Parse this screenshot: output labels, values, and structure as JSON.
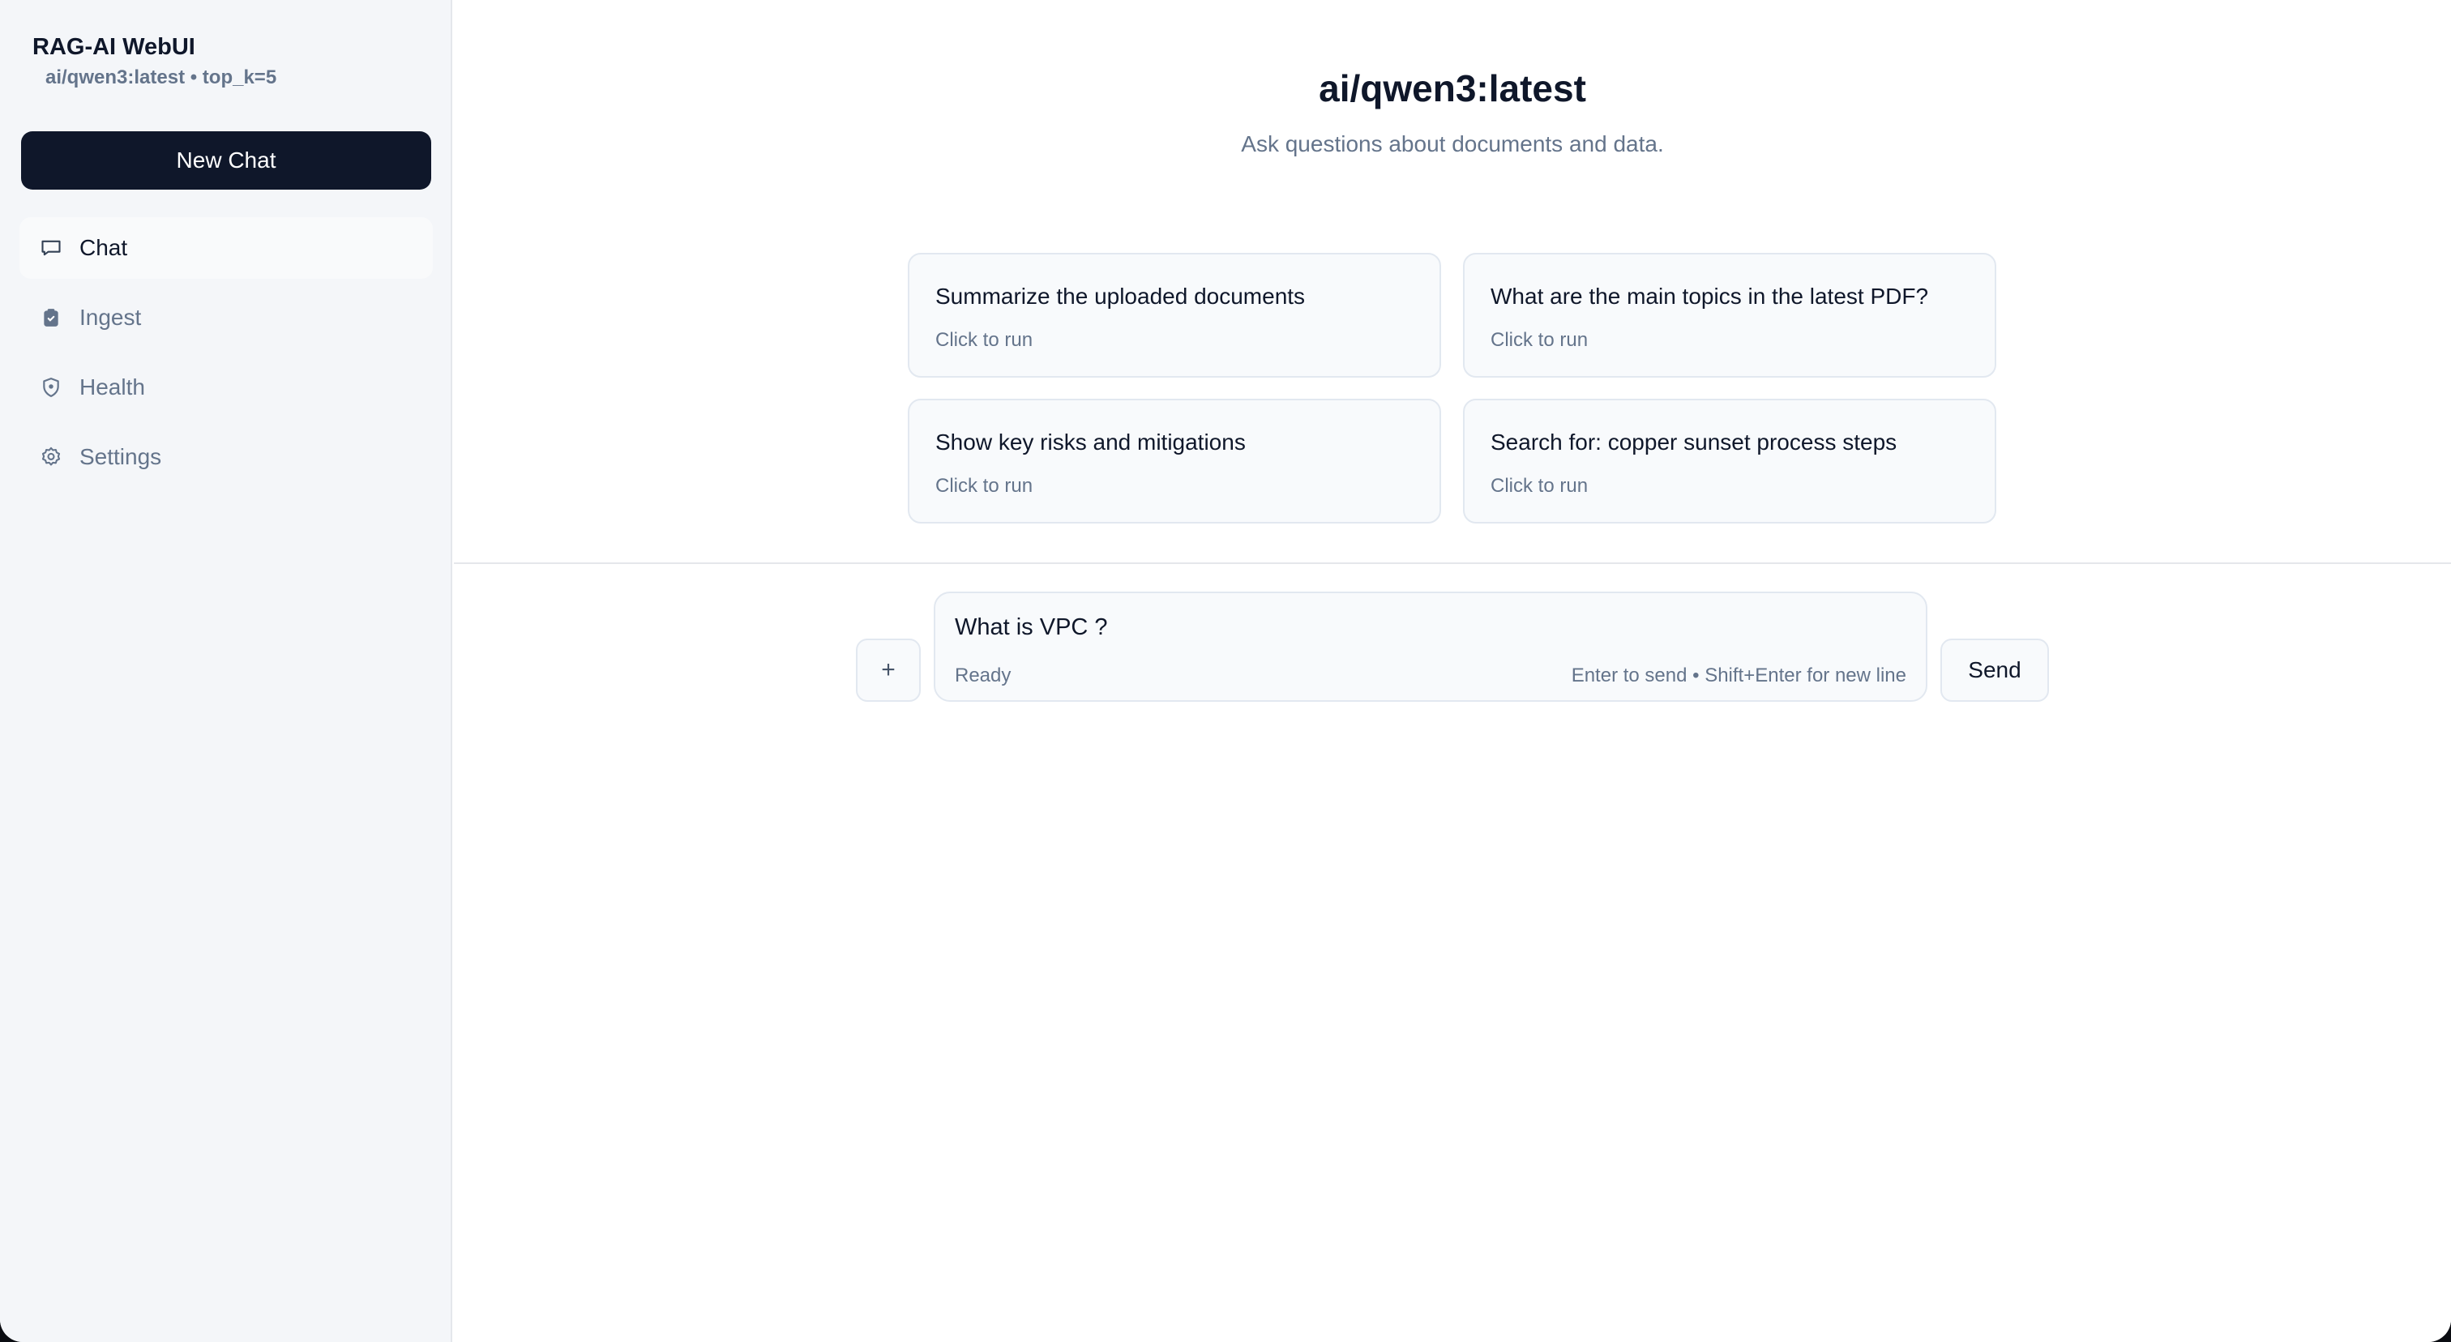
{
  "sidebar": {
    "brand": "RAG-AI WebUI",
    "brand_sub": "ai/qwen3:latest • top_k=5",
    "new_chat_label": "New Chat",
    "items": [
      {
        "label": "Chat",
        "icon": "chat-icon",
        "active": true
      },
      {
        "label": "Ingest",
        "icon": "clipboard-icon",
        "active": false
      },
      {
        "label": "Health",
        "icon": "shield-icon",
        "active": false
      },
      {
        "label": "Settings",
        "icon": "gear-icon",
        "active": false
      }
    ]
  },
  "main": {
    "title": "ai/qwen3:latest",
    "subtitle": "Ask questions about documents and data.",
    "suggestions": [
      {
        "title": "Summarize the uploaded documents",
        "hint": "Click to run"
      },
      {
        "title": "What are the main topics in the latest PDF?",
        "hint": "Click to run"
      },
      {
        "title": "Show key risks and mitigations",
        "hint": "Click to run"
      },
      {
        "title": "Search for: copper sunset process steps",
        "hint": "Click to run"
      }
    ]
  },
  "composer": {
    "attach_label": "+",
    "input_value": "What is VPC ?",
    "status": "Ready",
    "hint": "Enter to send • Shift+Enter for new line",
    "send_label": "Send"
  },
  "colors": {
    "primary": "#0f172a",
    "muted": "#64748b",
    "sidebar_bg": "#f4f6f9",
    "card_bg": "#f8fafc",
    "border": "#e2e8f0"
  }
}
